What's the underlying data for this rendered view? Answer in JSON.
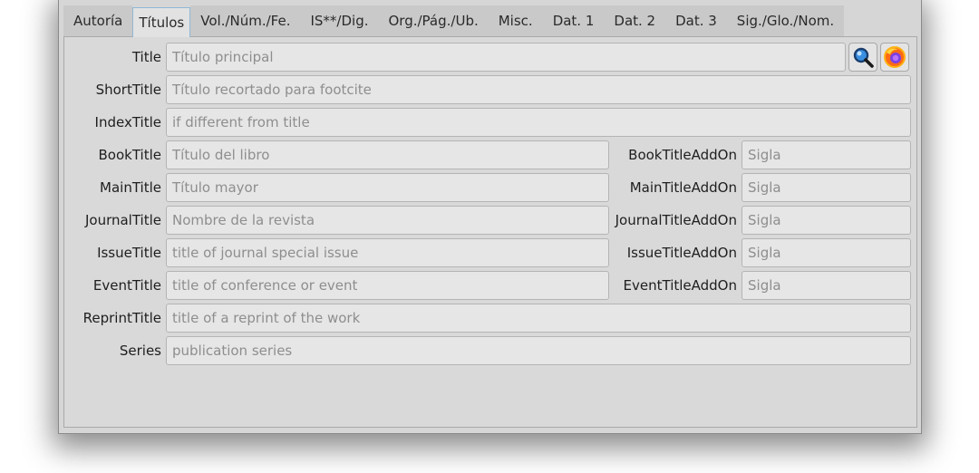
{
  "tabs": [
    {
      "label": "Autoría"
    },
    {
      "label": "Títulos"
    },
    {
      "label": "Vol./Núm./Fe."
    },
    {
      "label": "IS**/Dig."
    },
    {
      "label": "Org./Pág./Ub."
    },
    {
      "label": "Misc."
    },
    {
      "label": "Dat. 1"
    },
    {
      "label": "Dat. 2"
    },
    {
      "label": "Dat. 3"
    },
    {
      "label": "Sig./Glo./Nom."
    }
  ],
  "active_tab": "Títulos",
  "fields": {
    "title": {
      "label": "Title",
      "value": "",
      "placeholder": "Título principal"
    },
    "short_title": {
      "label": "ShortTitle",
      "value": "",
      "placeholder": "Título recortado para footcite"
    },
    "index_title": {
      "label": "IndexTitle",
      "value": "",
      "placeholder": "if different from title"
    },
    "book_title": {
      "label": "BookTitle",
      "value": "",
      "placeholder": "Título del libro"
    },
    "book_title_addon": {
      "label": "BookTitleAddOn",
      "value": "",
      "placeholder": "Sigla"
    },
    "main_title": {
      "label": "MainTitle",
      "value": "",
      "placeholder": "Título mayor"
    },
    "main_title_addon": {
      "label": "MainTitleAddOn",
      "value": "",
      "placeholder": "Sigla"
    },
    "journal_title": {
      "label": "JournalTitle",
      "value": "",
      "placeholder": "Nombre de la revista"
    },
    "journal_title_addon": {
      "label": "JournalTitleAddOn",
      "value": "",
      "placeholder": "Sigla"
    },
    "issue_title": {
      "label": "IssueTitle",
      "value": "",
      "placeholder": "title of journal special issue"
    },
    "issue_title_addon": {
      "label": "IssueTitleAddOn",
      "value": "",
      "placeholder": "Sigla"
    },
    "event_title": {
      "label": "EventTitle",
      "value": "",
      "placeholder": "title of conference or event"
    },
    "event_title_addon": {
      "label": "EventTitleAddOn",
      "value": "",
      "placeholder": "Sigla"
    },
    "reprint_title": {
      "label": "ReprintTitle",
      "value": "",
      "placeholder": "title of a reprint of the work"
    },
    "series": {
      "label": "Series",
      "value": "",
      "placeholder": "publication series"
    }
  },
  "icons": {
    "search": "magnifier-search-icon",
    "firefox": "firefox-browser-icon"
  }
}
